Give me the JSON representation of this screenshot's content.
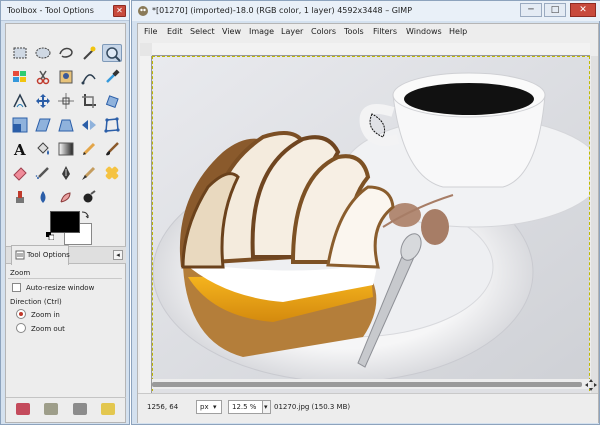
{
  "toolbox": {
    "title": "Toolbox - Tool Options",
    "close_label": "✕",
    "tab_label": "Tool Options",
    "tab_arrow": "◂",
    "tools": [
      "rect-select",
      "ellipse-select",
      "free-select",
      "fuzzy-select",
      "select-by-color",
      "scissors-select",
      "foreground-select",
      "paths",
      "color-picker",
      "zoom",
      "measure",
      "move",
      "align",
      "crop",
      "rotate",
      "scale",
      "shear",
      "perspective",
      "flip",
      "cage-transform",
      "unified-transform",
      "text",
      "bucket-fill",
      "blend",
      "pencil",
      "paintbrush",
      "eraser",
      "airbrush",
      "ink",
      "mypaint-brush",
      "heal",
      "clone",
      "smudge",
      "dodge-burn"
    ],
    "options": {
      "heading": "Zoom",
      "auto_resize_label": "Auto-resize window",
      "direction_label": "Direction  (Ctrl)",
      "zoom_in_label": "Zoom in",
      "zoom_out_label": "Zoom out",
      "direction_selected": "Zoom in"
    }
  },
  "image_window": {
    "title": "*[01270] (imported)-18.0 (RGB color, 1 layer) 4592x3448 – GIMP",
    "minimize_label": "─",
    "maximize_label": "□",
    "close_label": "✕",
    "menu": [
      "File",
      "Edit",
      "Select",
      "View",
      "Image",
      "Layer",
      "Colors",
      "Tools",
      "Filters",
      "Windows",
      "Help"
    ]
  },
  "status": {
    "pointer_coords": "1256, 64",
    "unit": "px",
    "zoom": "12.5 %",
    "file_info": "01270.jpg (150.3 MB)"
  },
  "colors": {
    "window_frame": "#d4e1ef",
    "title_bar": "#e9f0f8",
    "close_button": "#c84a3c",
    "panel_bg": "#ededed",
    "foreground_color": "#000000",
    "background_color": "#ffffff"
  }
}
